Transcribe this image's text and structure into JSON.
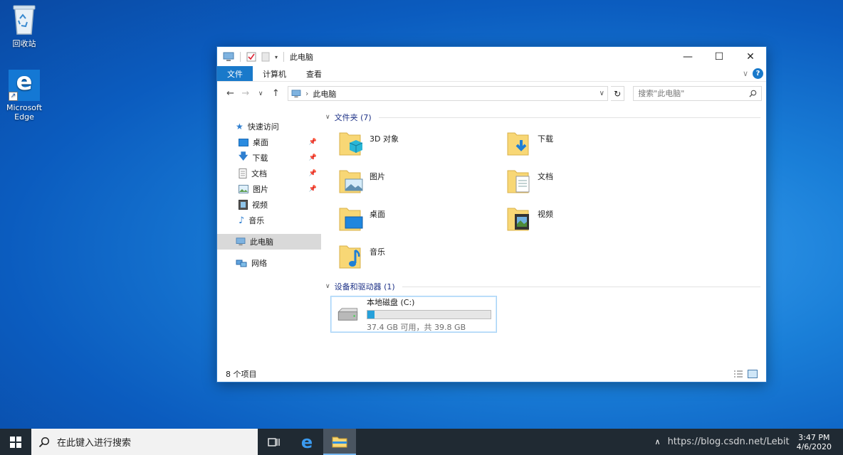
{
  "desktop": {
    "icons": [
      {
        "label": "回收站"
      },
      {
        "label": "Microsoft Edge"
      }
    ]
  },
  "window": {
    "title": "此电脑",
    "controls": {
      "minimize": "—",
      "maximize": "☐",
      "close": "✕"
    },
    "ribbon_tabs": [
      "文件",
      "计算机",
      "查看"
    ],
    "address_path": "此电脑",
    "search_placeholder": "搜索\"此电脑\"",
    "sidebar": {
      "quick_access": "快速访问",
      "quick_items": [
        {
          "label": "桌面",
          "pinned": true
        },
        {
          "label": "下载",
          "pinned": true
        },
        {
          "label": "文档",
          "pinned": true
        },
        {
          "label": "图片",
          "pinned": true
        },
        {
          "label": "视频",
          "pinned": false
        },
        {
          "label": "音乐",
          "pinned": false
        }
      ],
      "this_pc": "此电脑",
      "network": "网络"
    },
    "folders_header": "文件夹 (7)",
    "folders": [
      "3D 对象",
      "下载",
      "图片",
      "文档",
      "桌面",
      "视频",
      "音乐"
    ],
    "devices_header": "设备和驱动器 (1)",
    "drive": {
      "name": "本地磁盘 (C:)",
      "size_text": "37.4 GB 可用，共 39.8 GB",
      "used_fraction": 0.06
    },
    "status": "8 个项目"
  },
  "taskbar": {
    "search_placeholder": "在此键入进行搜索",
    "time": "3:47 PM",
    "date": "4/6/2020",
    "watermark": "https://blog.csdn.net/Lebit"
  },
  "colors": {
    "accent": "#1979ca",
    "folder": "#f8d775",
    "taskbar": "#202a33"
  }
}
